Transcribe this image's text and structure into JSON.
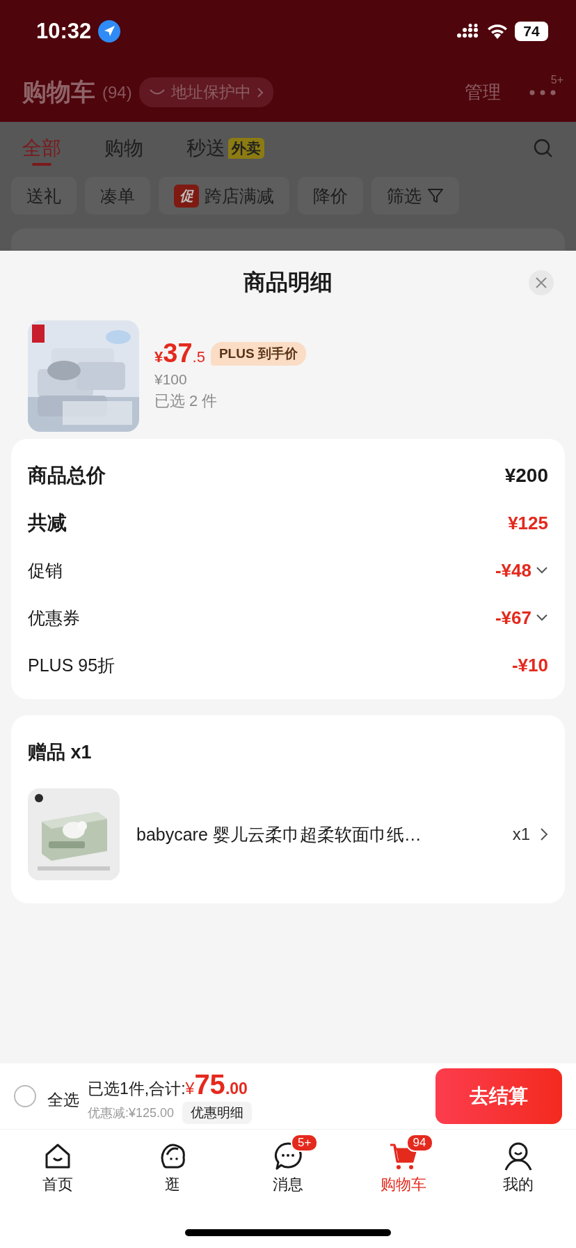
{
  "status_bar": {
    "time": "10:32",
    "battery": "74"
  },
  "header": {
    "title": "购物车",
    "count": "(94)",
    "address_badge": "地址保护中",
    "manage": "管理",
    "more_badge": "5+"
  },
  "tabs": [
    {
      "label": "全部",
      "selected": true
    },
    {
      "label": "购物",
      "selected": false
    },
    {
      "label": "秒送",
      "badge": "外卖",
      "selected": false
    }
  ],
  "chips": [
    {
      "label": "送礼",
      "kind": "plain"
    },
    {
      "label": "凑单",
      "kind": "plain"
    },
    {
      "label": "跨店满减",
      "kind": "promo",
      "tag": "促"
    },
    {
      "label": "降价",
      "kind": "plain"
    },
    {
      "label": "筛选",
      "kind": "filter"
    }
  ],
  "sheet": {
    "title": "商品明细",
    "product": {
      "kind": "picture",
      "currency": "¥",
      "price_int": "37",
      "price_dec": ".5",
      "plus_badge": "PLUS 到手价",
      "original_price": "¥100",
      "selected_count": "已选 2 件"
    },
    "summary": [
      {
        "label": "商品总价",
        "value": "¥200",
        "kind": "total"
      },
      {
        "label": "共减",
        "value": "¥125",
        "kind": "reduction"
      },
      {
        "label": "促销",
        "value": "-¥48",
        "kind": "expandable"
      },
      {
        "label": "优惠券",
        "value": "-¥67",
        "kind": "expandable"
      },
      {
        "label": "PLUS 95折",
        "value": "-¥10",
        "kind": "detail"
      }
    ],
    "gifts": {
      "title": "赠品 x1",
      "items": [
        {
          "kind": "picture",
          "name": "babycare 婴儿云柔巾超柔软面巾纸…",
          "qty": "x1"
        }
      ]
    }
  },
  "checkout": {
    "select_all": {
      "label": "全选",
      "checked": false
    },
    "summary": "已选1件,合计:",
    "currency": "¥",
    "total_int": "75",
    "total_dec": ".00",
    "discount": "优惠减:¥125.00",
    "detail_button": "优惠明细",
    "checkout_button": "去结算"
  },
  "tabbar": [
    {
      "label": "首页",
      "selected": false
    },
    {
      "label": "逛",
      "selected": false
    },
    {
      "label": "消息",
      "badge": "5+",
      "selected": false
    },
    {
      "label": "购物车",
      "badge": "94",
      "selected": true
    },
    {
      "label": "我的",
      "selected": false
    }
  ]
}
